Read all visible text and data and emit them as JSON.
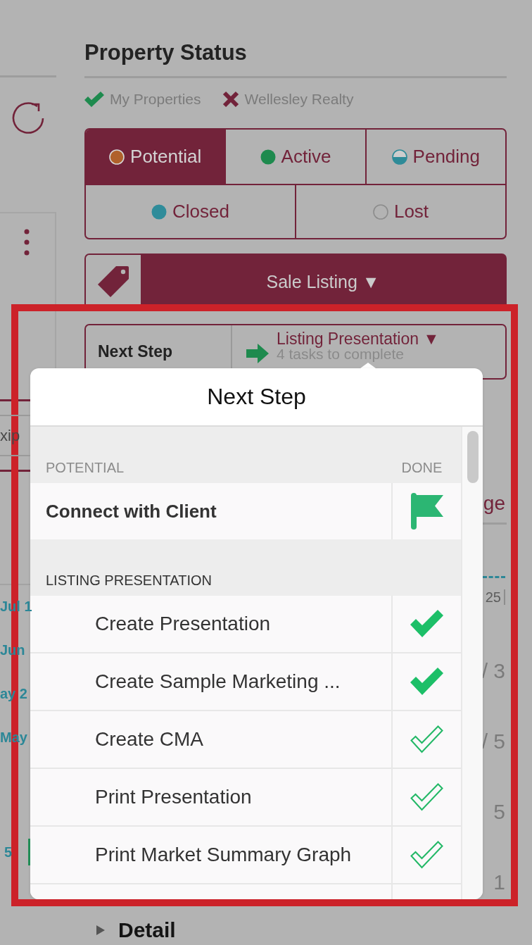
{
  "side_panel": {
    "field_value": "xip",
    "dates": [
      "Jul 1",
      "Jun",
      "ay 2",
      "May"
    ],
    "count": "5"
  },
  "property_status": {
    "title": "Property Status",
    "filters": [
      {
        "label": "My Properties",
        "included": true
      },
      {
        "label": "Wellesley Realty",
        "included": false
      }
    ],
    "statuses": [
      {
        "label": "Potential",
        "selected": true,
        "kind": "solid",
        "color": "#b0612b"
      },
      {
        "label": "Active",
        "selected": false,
        "kind": "solid",
        "color": "#1e8a4e"
      },
      {
        "label": "Pending",
        "selected": false,
        "kind": "half",
        "color": "#2e8b98"
      },
      {
        "label": "Closed",
        "selected": false,
        "kind": "solid",
        "color": "#2f8c9a"
      },
      {
        "label": "Lost",
        "selected": false,
        "kind": "ring",
        "color": "#8c8c8c"
      }
    ],
    "listing_type": "Sale Listing ▼",
    "next_step": {
      "label": "Next Step",
      "value": "Listing Presentation ▼",
      "subtitle": "4 tasks to complete"
    }
  },
  "right_edge": {
    "tab_fragment": "ge",
    "axis_fragment": "25",
    "values": [
      "/ 3",
      "/ 5",
      "5",
      "1"
    ]
  },
  "popover": {
    "title": "Next Step",
    "sections": [
      {
        "title": "POTENTIAL",
        "column": "DONE",
        "current": false,
        "tasks": [
          {
            "label": "Connect with Client",
            "kind": "milestone"
          }
        ]
      },
      {
        "title": "LISTING PRESENTATION",
        "current": true,
        "tasks": [
          {
            "label": "Create Presentation",
            "kind": "task",
            "done": true
          },
          {
            "label": "Create Sample Marketing ...",
            "kind": "task",
            "done": true
          },
          {
            "label": "Create CMA",
            "kind": "task",
            "done": false
          },
          {
            "label": "Print Presentation",
            "kind": "task",
            "done": false
          },
          {
            "label": "Print Market Summary Graph",
            "kind": "task",
            "done": false
          }
        ]
      }
    ]
  },
  "footer": {
    "heading": "Detail"
  }
}
